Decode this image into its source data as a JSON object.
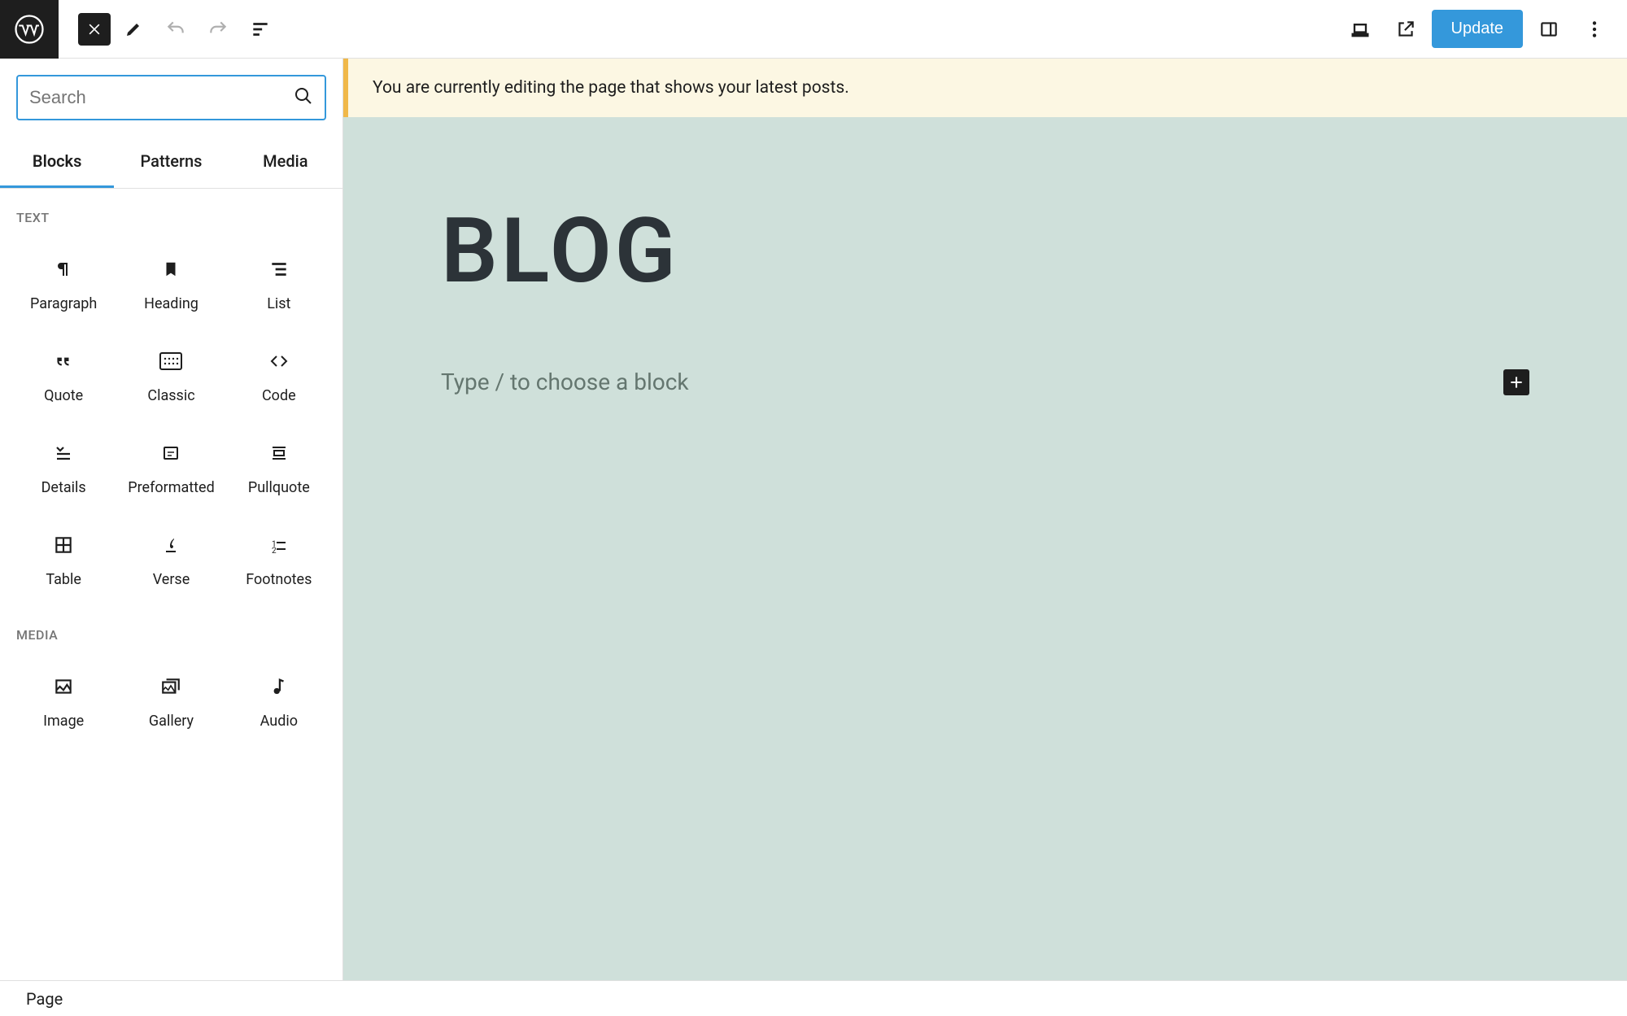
{
  "topbar": {
    "update_label": "Update"
  },
  "inserter": {
    "search_placeholder": "Search",
    "tabs": [
      "Blocks",
      "Patterns",
      "Media"
    ],
    "active_tab": 0,
    "categories": [
      {
        "label": "TEXT",
        "blocks": [
          {
            "name": "paragraph",
            "label": "Paragraph"
          },
          {
            "name": "heading",
            "label": "Heading"
          },
          {
            "name": "list",
            "label": "List"
          },
          {
            "name": "quote",
            "label": "Quote"
          },
          {
            "name": "classic",
            "label": "Classic"
          },
          {
            "name": "code",
            "label": "Code"
          },
          {
            "name": "details",
            "label": "Details"
          },
          {
            "name": "preformatted",
            "label": "Preformatted"
          },
          {
            "name": "pullquote",
            "label": "Pullquote"
          },
          {
            "name": "table",
            "label": "Table"
          },
          {
            "name": "verse",
            "label": "Verse"
          },
          {
            "name": "footnotes",
            "label": "Footnotes"
          }
        ]
      },
      {
        "label": "MEDIA",
        "blocks": [
          {
            "name": "image",
            "label": "Image"
          },
          {
            "name": "gallery",
            "label": "Gallery"
          },
          {
            "name": "audio",
            "label": "Audio"
          }
        ]
      }
    ]
  },
  "notice": {
    "text": "You are currently editing the page that shows your latest posts."
  },
  "canvas": {
    "title": "BLOG",
    "placeholder": "Type / to choose a block"
  },
  "bottombar": {
    "breadcrumb": "Page"
  }
}
